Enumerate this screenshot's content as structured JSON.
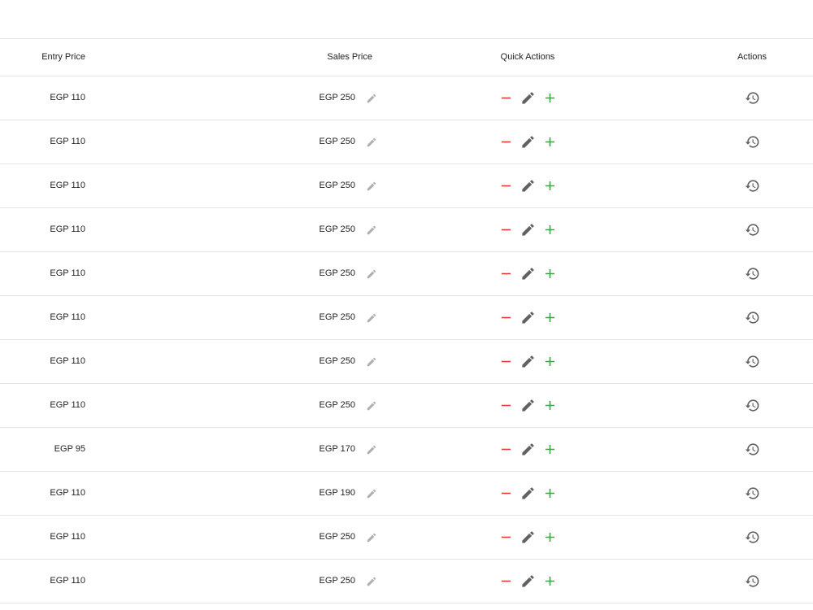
{
  "table": {
    "headers": {
      "entry_price": "Entry Price",
      "sales_price": "Sales Price",
      "quick_actions": "Quick Actions",
      "actions": "Actions"
    },
    "rows": [
      {
        "entry_price": "EGP 110",
        "sales_price": "EGP 250"
      },
      {
        "entry_price": "EGP 110",
        "sales_price": "EGP 250"
      },
      {
        "entry_price": "EGP 110",
        "sales_price": "EGP 250"
      },
      {
        "entry_price": "EGP 110",
        "sales_price": "EGP 250"
      },
      {
        "entry_price": "EGP 110",
        "sales_price": "EGP 250"
      },
      {
        "entry_price": "EGP 110",
        "sales_price": "EGP 250"
      },
      {
        "entry_price": "EGP 110",
        "sales_price": "EGP 250"
      },
      {
        "entry_price": "EGP 110",
        "sales_price": "EGP 250"
      },
      {
        "entry_price": "EGP 95",
        "sales_price": "EGP 170"
      },
      {
        "entry_price": "EGP 110",
        "sales_price": "EGP 190"
      },
      {
        "entry_price": "EGP 110",
        "sales_price": "EGP 250"
      },
      {
        "entry_price": "EGP 110",
        "sales_price": "EGP 250"
      }
    ]
  },
  "icons": {
    "edit_price": "pencil-icon",
    "decrease": "minus-icon",
    "edit": "pencil-icon",
    "increase": "plus-icon",
    "history": "history-icon"
  },
  "colors": {
    "minus": "#e53935",
    "plus": "#43a047",
    "edit_dark": "#616161",
    "edit_light": "#b0b0b0",
    "history": "#616161",
    "divider": "#e3e3e3"
  }
}
